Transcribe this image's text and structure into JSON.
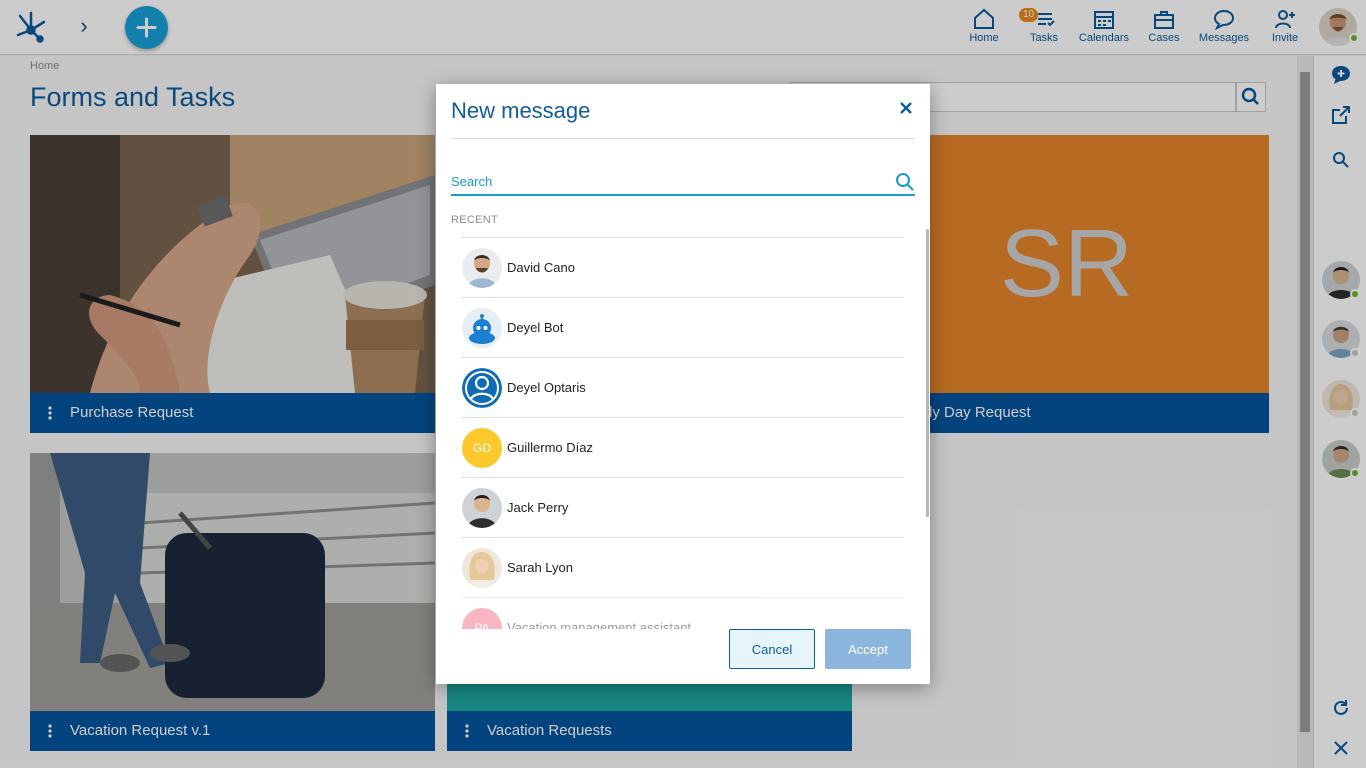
{
  "topbar": {
    "nav": [
      {
        "label": "Home",
        "icon": "home-icon"
      },
      {
        "label": "Tasks",
        "icon": "tasks-icon",
        "badge": "10"
      },
      {
        "label": "Calendars",
        "icon": "calendar-icon"
      },
      {
        "label": "Cases",
        "icon": "briefcase-icon"
      },
      {
        "label": "Messages",
        "icon": "message-icon"
      },
      {
        "label": "Invite",
        "icon": "add-user-icon"
      }
    ]
  },
  "main": {
    "breadcrumb": "Home",
    "title": "Forms and Tasks",
    "cards": [
      {
        "label": "Purchase Request"
      },
      {
        "label": "dy Day Request",
        "initials": "SR"
      },
      {
        "label": "Vacation Request v.1"
      },
      {
        "label": "Vacation Requests"
      }
    ]
  },
  "modal": {
    "title": "New message",
    "search_placeholder": "Search",
    "section": "RECENT",
    "contacts": [
      {
        "name": "David Cano"
      },
      {
        "name": "Deyel Bot"
      },
      {
        "name": "Deyel Optaris"
      },
      {
        "name": "Guillermo Díaz",
        "initials": "GD"
      },
      {
        "name": "Jack Perry"
      },
      {
        "name": "Sarah Lyon"
      },
      {
        "name": "Vacation management assistant",
        "initials": "PA"
      }
    ],
    "cancel": "Cancel",
    "accept": "Accept"
  },
  "colors": {
    "brand_blue": "#06569e",
    "accent_cyan": "#18a0d8",
    "badge_orange": "#e88a1e",
    "sr_orange": "#e5862b",
    "online_green": "#6ab42d"
  }
}
